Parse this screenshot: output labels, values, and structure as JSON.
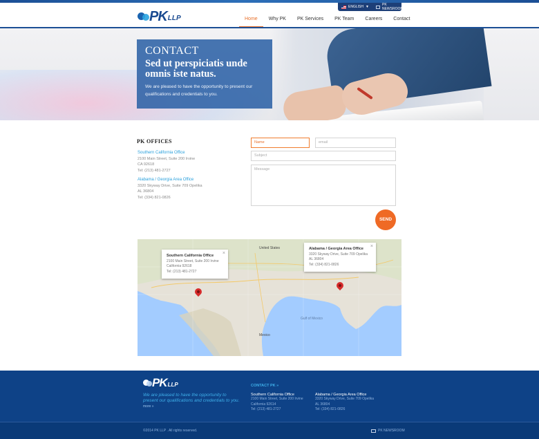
{
  "util": {
    "language": "ENGLISH",
    "newsroom": "PK NEWSROOM"
  },
  "logo": {
    "name": "PK",
    "suffix": "LLP"
  },
  "nav": [
    "Home",
    "Why PK",
    "PK Services",
    "PK Team",
    "Careers",
    "Contact"
  ],
  "hero": {
    "label": "CONTACT",
    "headline": "Sed ut perspiciatis unde omnis iste natus.",
    "text": "We are pleased to have the opportunity to present our qualifications and credentials to you."
  },
  "offices": {
    "title": "PK OFFICES",
    "list": [
      {
        "name": "Southern California Office",
        "street": "2100 Main Street, Suite 200 Irvine",
        "city": "CA 92618",
        "tel": "Tel: (213) 481-2727"
      },
      {
        "name": "Alabama / Georgia Area Office",
        "street": "3320 Skyway Drive, Suite 709 Opelika",
        "city": "AL 36804",
        "tel": "Tel: (334) 821-0826"
      }
    ]
  },
  "form": {
    "name_placeholder": "Name",
    "email_placeholder": "email",
    "subject_placeholder": "Subject",
    "message_placeholder": "Message",
    "send": "SEND"
  },
  "map": {
    "popups": [
      {
        "title": "Southern California Office",
        "l1": "2100 Main Street, Suite 200 Irvine",
        "l2": "California 92618",
        "l3": "Tel: (213) 481-2727"
      },
      {
        "title": "Alabama / Georgia Area Office",
        "l1": "3320 Skyway Drive, Suite 709 Opelika",
        "l2": "AL 36804",
        "l3": "Tel: (334) 821-0826"
      }
    ],
    "labels": {
      "us": "United States",
      "gulf": "Gulf of Mexico",
      "mexico": "Mexico"
    }
  },
  "footer": {
    "tagline": "We are pleased to have the opportunity to present our qualifications and credentials to you.",
    "more": "more »",
    "contact_head": "CONTACT PK »",
    "offices": [
      {
        "name": "Southern California Office",
        "l1": "2100 Main Street, Suite 200 Irvine",
        "l2": "California 92614",
        "l3": "Tel: (213) 481-2727"
      },
      {
        "name": "Alabama / Georgia Area Office",
        "l1": "3320 Skyway Drive, Suite 709 Opelika",
        "l2": "AL 36804",
        "l3": "Tel: (334) 821-0826"
      }
    ],
    "copyright": "©2014 PK LLP . All rights reserved.",
    "newsroom": "PK NEWSROOM"
  },
  "colors": {
    "brand": "#1b4f95",
    "accent": "#e8702a",
    "link": "#2aa0dc"
  }
}
